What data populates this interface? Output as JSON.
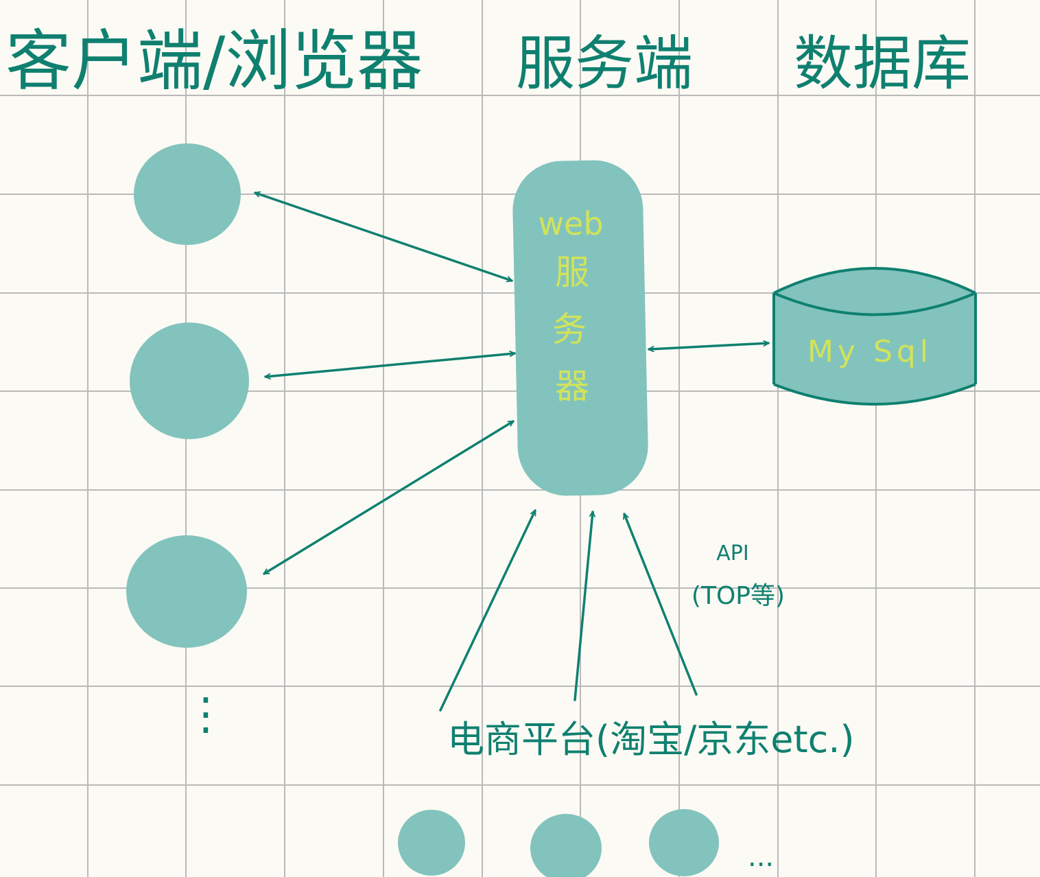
{
  "headers": {
    "client": "客户端/浏览器",
    "server": "服务端",
    "database": "数据库"
  },
  "server": {
    "line1": "web",
    "line2": "服",
    "line3": "务",
    "line4": "器"
  },
  "database": {
    "label": "My Sql"
  },
  "api": {
    "line1": "API",
    "line2": "(TOP等)"
  },
  "platform": {
    "label": "电商平台(淘宝/京东etc.)"
  },
  "ellipsis": {
    "clients": "⋮",
    "platforms": "..."
  },
  "colors": {
    "background": "#fcfaf4",
    "grid": "#b9b9b9",
    "ink": "#0f8070",
    "fill": "#82c3bd",
    "accent": "#d2e35a"
  }
}
